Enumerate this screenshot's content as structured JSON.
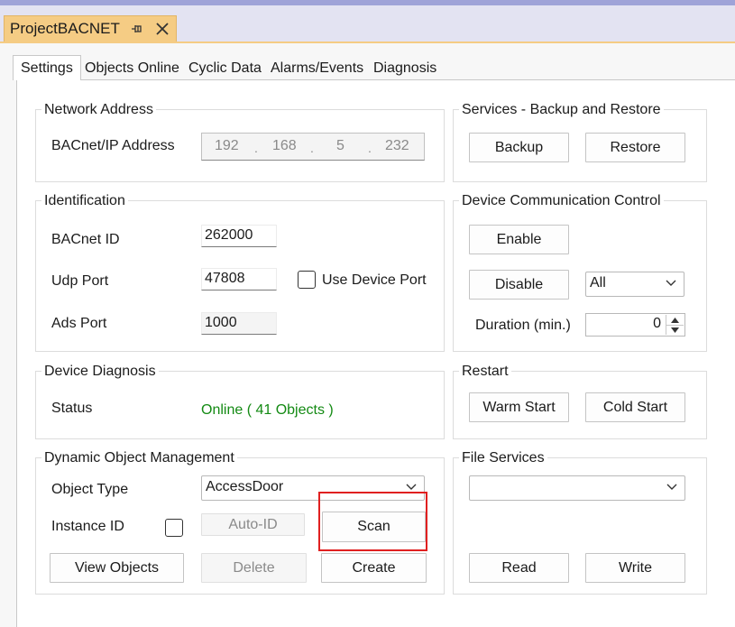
{
  "document_tab": {
    "title": "ProjectBACNET"
  },
  "tabs": [
    "Settings",
    "Objects Online",
    "Cyclic Data",
    "Alarms/Events",
    "Diagnosis"
  ],
  "network_address": {
    "title": "Network Address",
    "ip_label": "BACnet/IP Address",
    "octets": [
      "192",
      "168",
      "5",
      "232"
    ]
  },
  "services": {
    "title": "Services - Backup and Restore",
    "backup": "Backup",
    "restore": "Restore"
  },
  "identification": {
    "title": "Identification",
    "bacnet_id_label": "BACnet ID",
    "bacnet_id_value": "262000",
    "udp_port_label": "Udp Port",
    "udp_port_value": "47808",
    "use_device_port": "Use Device Port",
    "ads_port_label": "Ads Port",
    "ads_port_value": "1000"
  },
  "device_comm": {
    "title": "Device Communication Control",
    "enable": "Enable",
    "disable": "Disable",
    "scope_selected": "All",
    "duration_label": "Duration (min.)",
    "duration_value": "0"
  },
  "device_diagnosis": {
    "title": "Device Diagnosis",
    "status_label": "Status",
    "status_value": "Online ( 41 Objects )"
  },
  "restart": {
    "title": "Restart",
    "warm": "Warm Start",
    "cold": "Cold Start"
  },
  "dynamic_objects": {
    "title": "Dynamic Object Management",
    "object_type_label": "Object Type",
    "object_type_value": "AccessDoor",
    "instance_id_label": "Instance ID",
    "auto_id": "Auto-ID",
    "scan": "Scan",
    "view_objects": "View Objects",
    "delete": "Delete",
    "create": "Create"
  },
  "file_services": {
    "title": "File Services",
    "selected_file": "",
    "read": "Read",
    "write": "Write"
  },
  "colors": {
    "doc_tab": "#f5cc84",
    "status_online": "#138a13",
    "highlight": "#e02020"
  }
}
